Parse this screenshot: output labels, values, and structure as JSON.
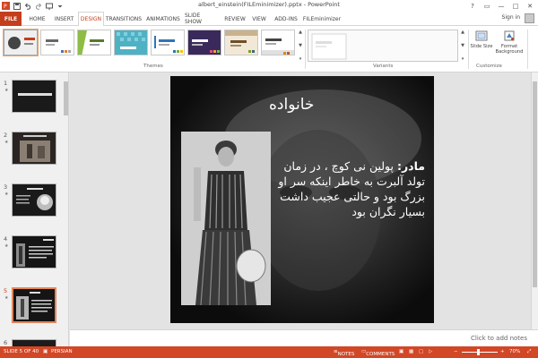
{
  "window": {
    "title": "albert_einstein(FILEminimizer).pptx - PowerPoint",
    "controls": [
      "?",
      "▭",
      "—",
      "□",
      "✕"
    ]
  },
  "qat": [
    "save-icon",
    "undo-icon",
    "redo-icon",
    "present-icon",
    "customize-icon"
  ],
  "tabs": [
    {
      "label": "FILE",
      "kind": "file"
    },
    {
      "label": "HOME"
    },
    {
      "label": "INSERT"
    },
    {
      "label": "DESIGN",
      "kind": "active"
    },
    {
      "label": "TRANSITIONS"
    },
    {
      "label": "ANIMATIONS"
    },
    {
      "label": "SLIDE SHOW"
    },
    {
      "label": "REVIEW"
    },
    {
      "label": "VIEW"
    },
    {
      "label": "ADD-INS"
    },
    {
      "label": "FILEminimizer"
    }
  ],
  "signin": "Sign in",
  "ribbon": {
    "themes_label": "Themes",
    "variants_label": "Variants",
    "customize_label": "Customize",
    "slide_size_label": "Slide Size",
    "format_background_label": "Format Background"
  },
  "slides_panel": {
    "numbers": [
      "1",
      "2",
      "3",
      "4",
      "5",
      "6"
    ],
    "current": "5"
  },
  "slide": {
    "title": "خانواده",
    "body_label": "مادر:",
    "body_text": " پولین نی کوچ ، در زمان تولد آلبرت به خاطر اینکه سر او بزرگ بود و حالتی عجیب داشت بسیار نگران بود"
  },
  "notes_placeholder": "Click to add notes",
  "status": {
    "slide_info": "SLIDE 5 OF 40",
    "language": "PERSIAN",
    "notes": "NOTES",
    "comments": "COMMENTS",
    "zoom": "70%"
  },
  "colors": {
    "accent": "#c43e1c",
    "status_bar": "#d24726",
    "slide_bg": "#111111"
  }
}
